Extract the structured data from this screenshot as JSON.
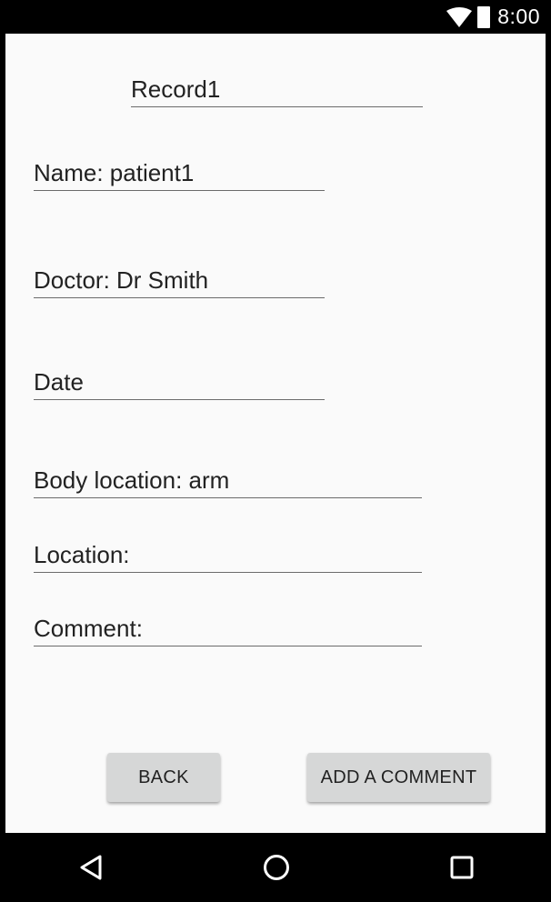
{
  "status_bar": {
    "time": "8:00",
    "icons": [
      "wifi-icon",
      "battery-icon"
    ]
  },
  "record": {
    "title": "Record1",
    "name": "Name: patient1",
    "doctor": "Doctor: Dr Smith",
    "date": "Date",
    "body_location": "Body location: arm",
    "location": "Location:",
    "comment": "Comment:"
  },
  "buttons": {
    "back": "BACK",
    "add_comment": "ADD A COMMENT"
  },
  "nav_bar": {
    "icons": [
      "back-icon",
      "home-icon",
      "recents-icon"
    ]
  }
}
